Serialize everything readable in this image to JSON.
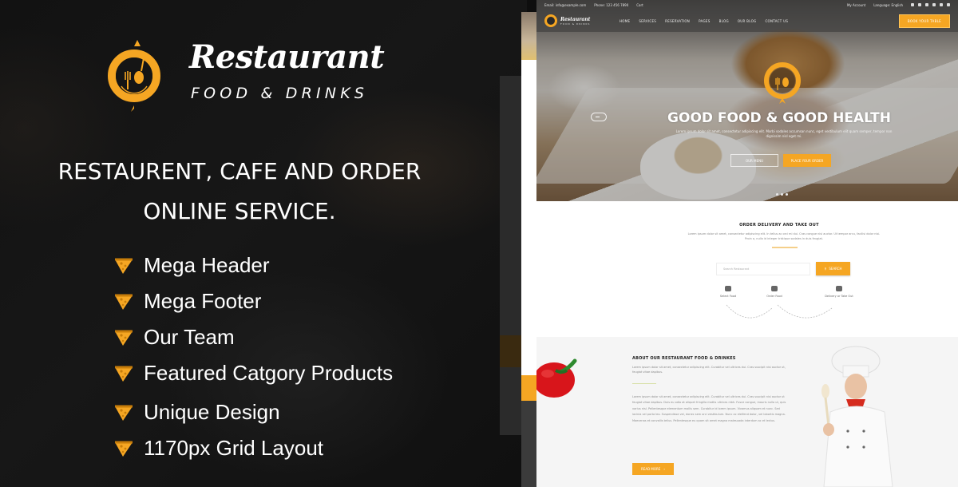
{
  "brand": {
    "name": "Restaurant",
    "tagline": "FOOD & DRINKS",
    "accent_color": "#f5a623"
  },
  "headline": {
    "line1": "RESTAURENT, CAFE AND ORDER",
    "line2": "ONLINE SERVICE."
  },
  "features": [
    {
      "icon": "pizza-slice-icon",
      "label": "Mega Header"
    },
    {
      "icon": "pizza-slice-icon",
      "label": "Mega Footer"
    },
    {
      "icon": "pizza-slice-icon",
      "label": "Our Team"
    },
    {
      "icon": "pizza-slice-icon",
      "label": "Featured Catgory Products"
    },
    {
      "icon": "pizza-slice-icon",
      "label": "Unique Design"
    },
    {
      "icon": "pizza-slice-icon",
      "label": "1170px Grid Layout"
    }
  ],
  "preview": {
    "topbar": {
      "email": "Email: info@example.com",
      "phone": "Phone: 123 456 7890",
      "cart": "Cart",
      "account": "My Account",
      "language": "Language: English"
    },
    "nav": {
      "logo_name": "Restaurant",
      "logo_tagline": "FOOD & DRINKS",
      "items": [
        "HOME",
        "SERVICES",
        "RESERVATION",
        "PAGES",
        "BLOG",
        "OUR BLOG",
        "CONTACT US"
      ],
      "cta": "BOOK YOUR TABLE"
    },
    "hero": {
      "title": "GOOD FOOD & GOOD HEALTH",
      "text": "Lorem ipsum dolor sit amet, consectetur adipiscing elit. Morbi sodales accumsan nunc, eget vestibulum elit quam semper, tempor non dignissim nisl eget mi.",
      "btn_menu": "OUR MENU",
      "btn_book": "PLACE YOUR ORDER",
      "slides": 3
    },
    "order": {
      "title": "ORDER DELIVERY AND TAKE OUT",
      "text": "Lorem ipsum dolor sit amet, consectetur adipiscing elit. In tellus ac orci mi dui. Cras congue nisi auctor. Ut tempor arcu, facilisi dolor nisi. Proin a, nulla id integer tristique sodales in duis feugiat.",
      "search_placeholder": "Search Restaurant",
      "search_button": "SEARCH",
      "steps": [
        "Select Food",
        "Order Food",
        "Delivery or Take Out"
      ]
    },
    "about": {
      "title": "ABOUT OUR RESTAURANT FOOD & DRINKES",
      "intro": "Lorem ipsum dolor sit amet, consectetur adipiscing elit. Curabitur vel ultrices dui. Cras suscipit nisi auctor ut, feugiat vitae dapibus.",
      "body": "Lorem ipsum dolor sit amet, consectetur adipiscing elit. Curabitur vel ultrices dui. Cras suscipit nisi auctor ut feugiat vitae dapibus. Duis eu odio at aliquet fringilla mattis ultrices nibh. Fusce congue, mauris nulla ut, quis varius nisl. Pellentesque elementum mollis sem. Curabitur id lorem ipsum. Vivamus aliquam et nunc. Sed lacinia vel porta leo. Suspendisse vel, donec sem orci vestibulum. Nunc ac eleifend dolor, vel lobortis magna. Maecenas et convallis tellus. Pellentesque eu quam sit amet magna malesuada interdum ac et lectus.",
      "button": "READ MORE"
    }
  }
}
